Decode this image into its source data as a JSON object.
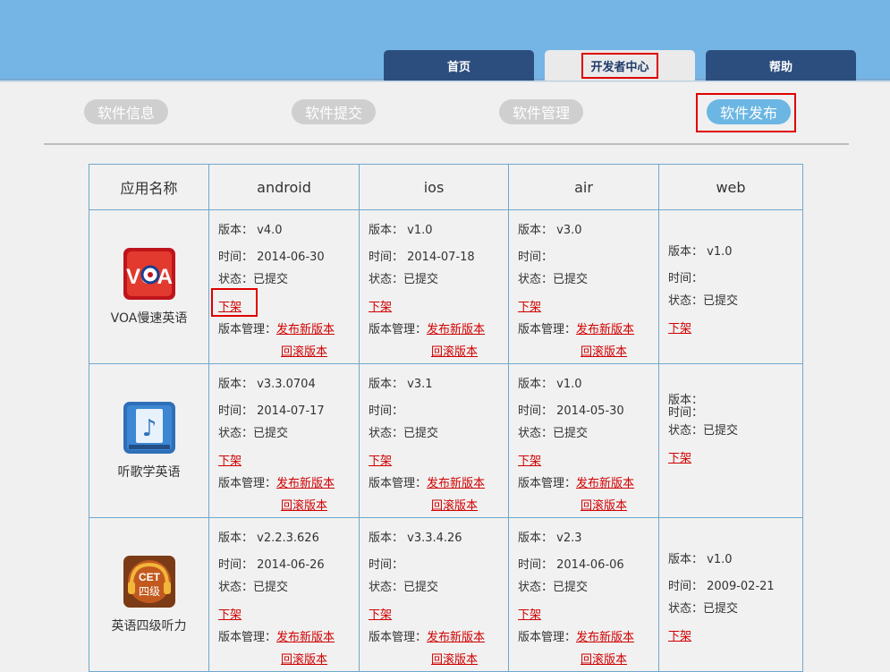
{
  "tabs": [
    {
      "label": "首页"
    },
    {
      "label": "开发者中心",
      "active": true
    },
    {
      "label": "帮助"
    }
  ],
  "subnav": [
    {
      "label": "软件信息"
    },
    {
      "label": "软件提交"
    },
    {
      "label": "软件管理"
    },
    {
      "label": "软件发布",
      "active": true
    }
  ],
  "table": {
    "headers": [
      "应用名称",
      "android",
      "ios",
      "air",
      "web"
    ],
    "labels": {
      "version": "版本：",
      "time": "时间：",
      "status": "状态：",
      "offline": "下架",
      "manage": "版本管理：",
      "publish": "发布新版本",
      "rollback": "回滚版本"
    },
    "rows": [
      {
        "app": "VOA慢速英语",
        "icon": "voa-app-icon",
        "android": {
          "version": "v4.0",
          "time": "2014-06-30",
          "status": "已提交"
        },
        "ios": {
          "version": "v1.0",
          "time": "2014-07-18",
          "status": "已提交"
        },
        "air": {
          "version": "v3.0",
          "time": "",
          "status": "已提交"
        },
        "web": {
          "version": "v1.0",
          "time": "",
          "status": "已提交"
        }
      },
      {
        "app": "听歌学英语",
        "icon": "music-app-icon",
        "android": {
          "version": "v3.3.0704",
          "time": "2014-07-17",
          "status": "已提交"
        },
        "ios": {
          "version": "v3.1",
          "time": "",
          "status": "已提交"
        },
        "air": {
          "version": "v1.0",
          "time": "2014-05-30",
          "status": "已提交"
        },
        "web": {
          "version": "",
          "time": "",
          "status": "已提交"
        }
      },
      {
        "app": "英语四级听力",
        "icon": "cet4-app-icon",
        "android": {
          "version": "v2.2.3.626",
          "time": "2014-06-26",
          "status": "已提交"
        },
        "ios": {
          "version": "v3.3.4.26",
          "time": "",
          "status": "已提交"
        },
        "air": {
          "version": "v2.3",
          "time": "2014-06-06",
          "status": "已提交"
        },
        "web": {
          "version": "v1.0",
          "time": "2009-02-21",
          "status": "已提交"
        }
      }
    ]
  },
  "colors": {
    "topbar": "#75b5e6",
    "tab_dark": "#2c4e7e",
    "subnav_active": "#6bb6e3",
    "link": "#d00000",
    "highlight": "#e00000"
  }
}
